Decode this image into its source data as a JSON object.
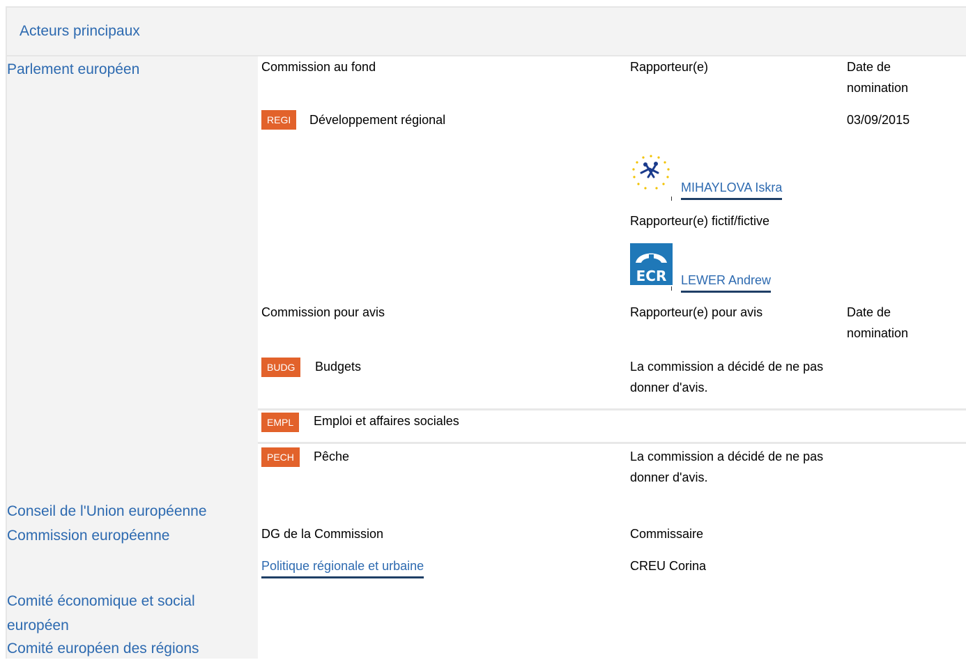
{
  "header": {
    "title": "Acteurs principaux"
  },
  "actors": {
    "parlement": "Parlement européen",
    "conseil": "Conseil de l'Union européenne",
    "commission": "Commission européenne",
    "cese_line1": "Comité économique et social",
    "cese_line2": "européen",
    "cdr": "Comité européen des régions"
  },
  "parliament": {
    "col_committee": "Commission au fond",
    "col_rapporteur": "Rapporteur(e)",
    "col_date": "Date de nomination",
    "lead": {
      "code": "REGI",
      "name": "Développement régional",
      "date": "03/09/2015",
      "rapporteur": "MIHAYLOVA Iskra",
      "rapporteur_group_icon": "alde-logo-icon",
      "shadow_label": "Rapporteur(e) fictif/fictive",
      "shadow": "LEWER Andrew",
      "shadow_group_icon": "ecr-logo-icon",
      "shadow_group_text": "ECR"
    },
    "opinion_header": {
      "col_committee": "Commission pour avis",
      "col_rapporteur": "Rapporteur(e) pour avis",
      "col_date": "Date de nomination"
    },
    "opinions": [
      {
        "code": "BUDG",
        "name": "Budgets",
        "note": "La commission a décidé de ne pas donner d'avis."
      },
      {
        "code": "EMPL",
        "name": "Emploi et affaires sociales",
        "note": ""
      },
      {
        "code": "PECH",
        "name": "Pêche",
        "note": "La commission a décidé de ne pas donner d'avis."
      }
    ]
  },
  "commission": {
    "col_dg": "DG de la Commission",
    "col_commissioner": "Commissaire",
    "dg": "Politique régionale et urbaine",
    "commissioner": "CREU Corina"
  },
  "colors": {
    "link": "#2d6ab0",
    "badge": "#e2622b",
    "panel": "#f3f3f3"
  }
}
